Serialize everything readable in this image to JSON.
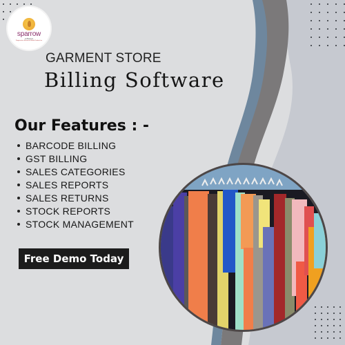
{
  "brand": {
    "logo_name": "sparrow",
    "logo_sub": "softwares",
    "logo_tag": "Progressive Business Made Productive"
  },
  "header": {
    "subtitle": "GARMENT STORE",
    "title": "Billing Software"
  },
  "features": {
    "heading": "Our Features : -",
    "items": [
      "BARCODE BILLING",
      "GST BILLING",
      "SALES CATEGORIES",
      "SALES REPORTS",
      "SALES RETURNS",
      "STOCK REPORTS",
      "STOCK MANAGEMENT"
    ]
  },
  "cta": {
    "label": "Free Demo Today"
  },
  "image": {
    "alt": "clothes-rack-photo"
  },
  "colors": {
    "background": "#dcdddf",
    "panel_right": "#c5c8cf",
    "wave_blue": "#6d859c",
    "wave_gray": "#7a7878",
    "button": "#1c1c1c"
  }
}
